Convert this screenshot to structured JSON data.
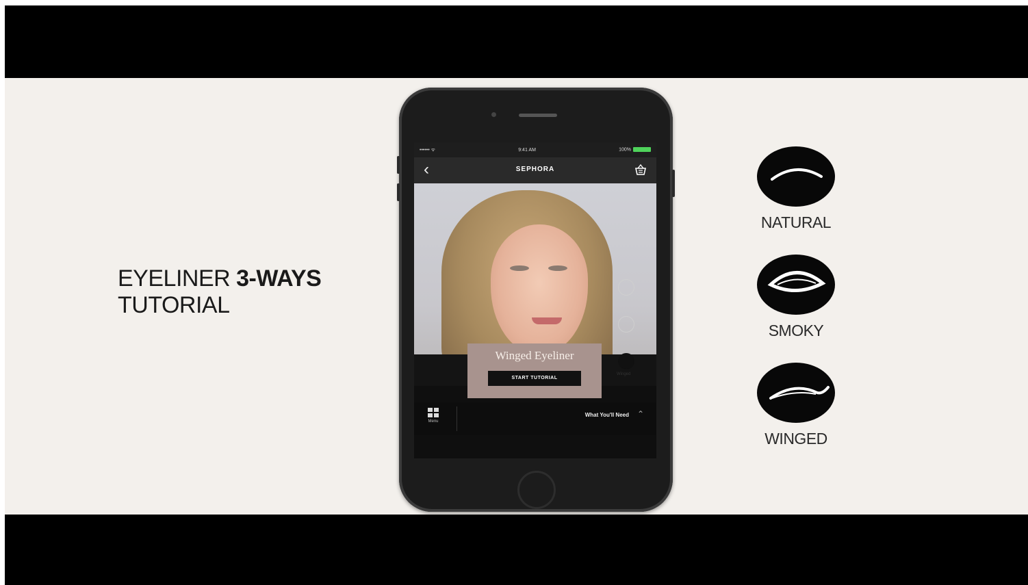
{
  "title": {
    "part1": "EYELINER ",
    "part2": "3-WAYS",
    "line2": "TUTORIAL"
  },
  "phone": {
    "status": {
      "carrier": "•••••• ᯤ",
      "time": "9:41 AM",
      "battery_text": "100%"
    },
    "nav": {
      "back": "‹",
      "brand": "SEPHORA"
    },
    "tutorial": {
      "name": "Winged Eyeliner",
      "button": "START TUTORIAL"
    },
    "bottom": {
      "menu_label": "Menu",
      "what_you_need": "What You'll Need",
      "chevron": "⌃"
    },
    "option_label": "Winged"
  },
  "styles": [
    {
      "label": "NATURAL"
    },
    {
      "label": "SMOKY"
    },
    {
      "label": "WINGED"
    }
  ],
  "colors": {
    "background": "#f3f0ec",
    "letterbox": "#000000",
    "tutorial_card": "#a8938e"
  }
}
